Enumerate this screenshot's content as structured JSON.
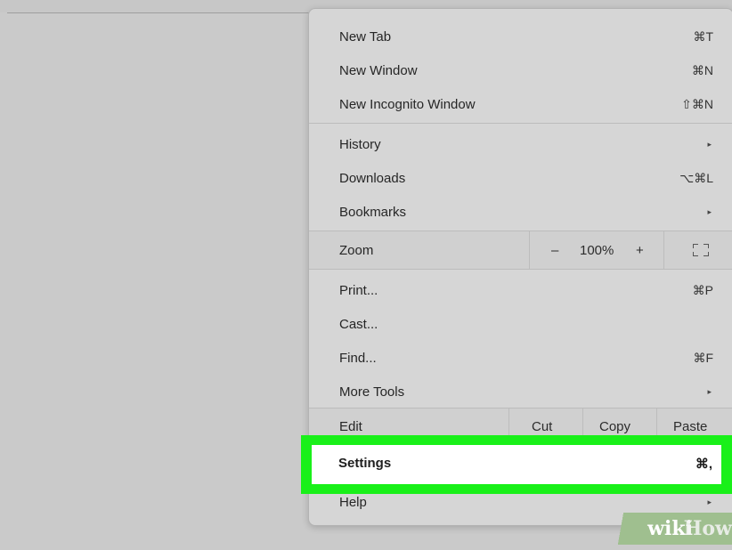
{
  "menu": {
    "new_tab": {
      "label": "New Tab",
      "shortcut": "⌘T"
    },
    "new_window": {
      "label": "New Window",
      "shortcut": "⌘N"
    },
    "new_incognito": {
      "label": "New Incognito Window",
      "shortcut": "⇧⌘N"
    },
    "history": {
      "label": "History",
      "arrow": "▸"
    },
    "downloads": {
      "label": "Downloads",
      "shortcut": "⌥⌘L"
    },
    "bookmarks": {
      "label": "Bookmarks",
      "arrow": "▸"
    },
    "zoom": {
      "label": "Zoom",
      "minus": "–",
      "level": "100%",
      "plus": "+"
    },
    "print": {
      "label": "Print...",
      "shortcut": "⌘P"
    },
    "cast": {
      "label": "Cast..."
    },
    "find": {
      "label": "Find...",
      "shortcut": "⌘F"
    },
    "more_tools": {
      "label": "More Tools",
      "arrow": "▸"
    },
    "edit": {
      "label": "Edit",
      "cut": "Cut",
      "copy": "Copy",
      "paste": "Paste"
    },
    "settings": {
      "label": "Settings",
      "shortcut": "⌘,"
    },
    "help": {
      "label": "Help",
      "arrow": "▸"
    }
  },
  "highlight": {
    "color": "#19f019"
  },
  "watermark": {
    "wiki": "wiki",
    "how": "How"
  }
}
